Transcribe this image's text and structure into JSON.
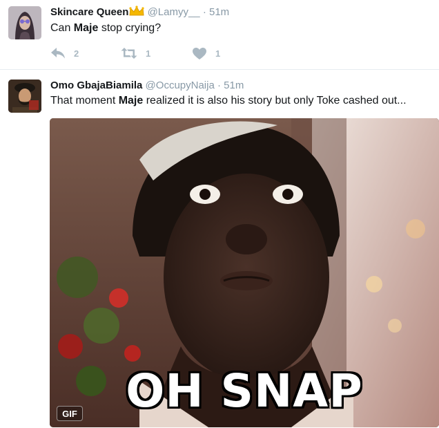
{
  "tweets": [
    {
      "name": "Skincare Queen",
      "handle": "@Lamyy__",
      "separator": "·",
      "time": "51m",
      "text_before": "Can ",
      "text_bold": "Maje",
      "text_after": " stop crying?",
      "reply_count": "2",
      "retweet_count": "1",
      "like_count": "1"
    },
    {
      "name": "Omo GbajaBiamila",
      "handle": "@OccupyNaija",
      "separator": "·",
      "time": "51m",
      "text_before": "That moment ",
      "text_bold": "Maje",
      "text_after": " realized it is also his story but only Toke cashed out...",
      "media_caption": "OH SNAP",
      "media_badge": "GIF"
    }
  ],
  "icons": {
    "reply": "reply-icon",
    "retweet": "retweet-icon",
    "like": "heart-icon",
    "verified_badge": "crown-icon"
  },
  "colors": {
    "text": "#14171a",
    "muted": "#8899a6",
    "action_icons": "#aab8c2",
    "crown": "#f5b800"
  }
}
